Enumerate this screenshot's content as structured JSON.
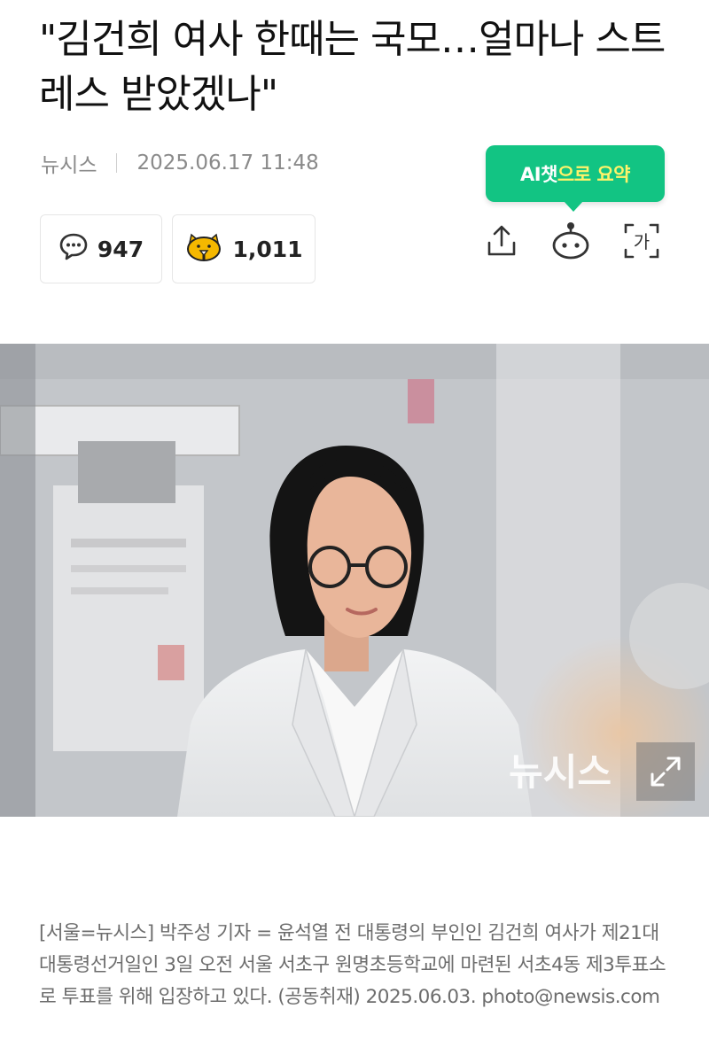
{
  "article": {
    "headline": "\"김건희 여사 한때는 국모…얼마나 스트레스 받았겠나\"",
    "press": "뉴시스",
    "date": "2025.06.17 11:48"
  },
  "ai_summary": {
    "label_prefix": "AI챗",
    "label_suffix": "으로 요약"
  },
  "stats": {
    "comments": "947",
    "reactions": "1,011"
  },
  "tools": {
    "share_icon": "share-icon",
    "bot_icon": "bot-icon",
    "font_icon_glyph": "가"
  },
  "photo": {
    "watermark": "뉴시스"
  },
  "caption": "[서울=뉴시스] 박주성 기자 = 윤석열 전 대통령의 부인인 김건희 여사가 제21대 대통령선거일인 3일 오전 서울 서초구 원명초등학교에 마련된 서초4동 제3투표소로 투표를 위해 입장하고 있다. (공동취재) 2025.06.03. photo@newsis.com",
  "colors": {
    "ai_green": "#12c483",
    "ai_yellow": "#fff36a",
    "meta_gray": "#8a8a8a",
    "caption_gray": "#6d6d6d",
    "reaction_yellow": "#f5b800"
  }
}
